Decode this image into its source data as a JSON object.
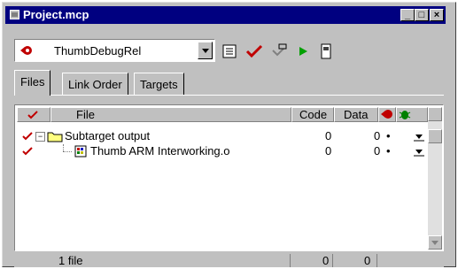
{
  "window": {
    "title": "Project.mcp",
    "buttons": [
      "minimize",
      "maximize",
      "close"
    ]
  },
  "toolbar": {
    "target_select": "ThumbDebugRel",
    "icons": [
      "settings-icon",
      "check-icon",
      "make-icon",
      "run-icon",
      "document-icon"
    ]
  },
  "tabs": [
    {
      "label": "Files",
      "active": true
    },
    {
      "label": "Link Order",
      "active": false
    },
    {
      "label": "Targets",
      "active": false
    }
  ],
  "columns": {
    "file": "File",
    "code": "Code",
    "data": "Data"
  },
  "rows": [
    {
      "name": "Subtarget output",
      "code": "0",
      "data": "0",
      "dot": "•",
      "type": "folder",
      "expanded": true
    },
    {
      "name": "Thumb ARM Interworking.o",
      "code": "0",
      "data": "0",
      "dot": "•",
      "type": "object"
    }
  ],
  "status": {
    "files": "1 file",
    "code_total": "0",
    "data_total": "0"
  },
  "colors": {
    "titlebar": "#000080",
    "chrome": "#c0c0c0",
    "checkmark": "#c00000"
  }
}
